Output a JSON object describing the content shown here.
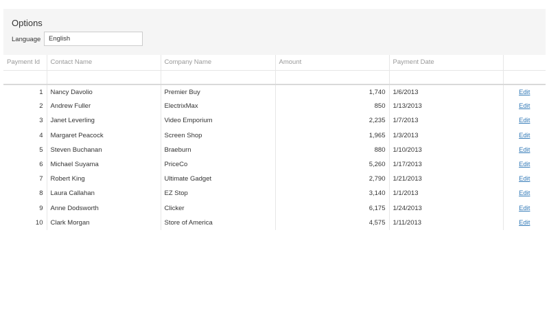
{
  "options": {
    "title": "Options",
    "language_label": "Language",
    "language_value": "English"
  },
  "grid": {
    "columns": [
      "Payment Id",
      "Contact Name",
      "Company Name",
      "Amount",
      "Payment Date",
      ""
    ],
    "edit_label": "Edit",
    "rows": [
      {
        "id": "1",
        "contact": "Nancy Davolio",
        "company": "Premier Buy",
        "amount": "1,740",
        "date": "1/6/2013"
      },
      {
        "id": "2",
        "contact": "Andrew Fuller",
        "company": "ElectrixMax",
        "amount": "850",
        "date": "1/13/2013"
      },
      {
        "id": "3",
        "contact": "Janet Leverling",
        "company": "Video Emporium",
        "amount": "2,235",
        "date": "1/7/2013"
      },
      {
        "id": "4",
        "contact": "Margaret Peacock",
        "company": "Screen Shop",
        "amount": "1,965",
        "date": "1/3/2013"
      },
      {
        "id": "5",
        "contact": "Steven Buchanan",
        "company": "Braeburn",
        "amount": "880",
        "date": "1/10/2013"
      },
      {
        "id": "6",
        "contact": "Michael Suyama",
        "company": "PriceCo",
        "amount": "5,260",
        "date": "1/17/2013"
      },
      {
        "id": "7",
        "contact": "Robert King",
        "company": "Ultimate Gadget",
        "amount": "2,790",
        "date": "1/21/2013"
      },
      {
        "id": "8",
        "contact": "Laura Callahan",
        "company": "EZ Stop",
        "amount": "3,140",
        "date": "1/1/2013"
      },
      {
        "id": "9",
        "contact": "Anne Dodsworth",
        "company": "Clicker",
        "amount": "6,175",
        "date": "1/24/2013"
      },
      {
        "id": "10",
        "contact": "Clark Morgan",
        "company": "Store of America",
        "amount": "4,575",
        "date": "1/11/2013"
      }
    ]
  }
}
